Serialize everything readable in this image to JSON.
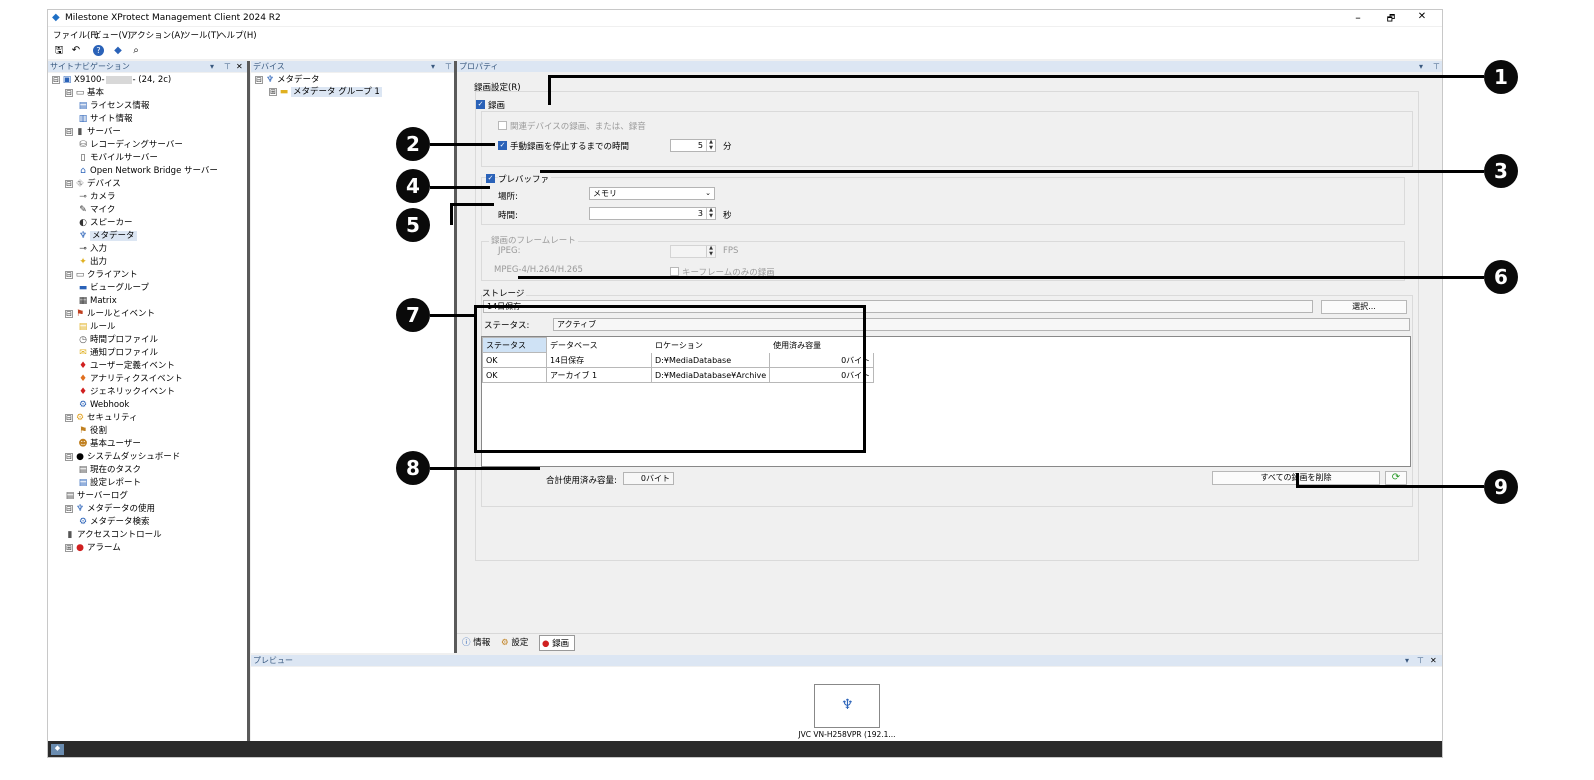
{
  "app": {
    "title": "Milestone XProtect Management Client 2024 R2",
    "minimize": "–",
    "restore": "🗗",
    "close": "✕"
  },
  "menu": [
    "ファイル(F)",
    "ビュー(V)",
    "アクション(A)",
    "ツール(T)",
    "ヘルプ(H)"
  ],
  "toolbar": {
    "save": "🖫",
    "undo": "↶",
    "help": "?",
    "connect": "◆",
    "find": "⌕"
  },
  "pane_controls": {
    "dropdown": "▾",
    "pin": "⊤",
    "close": "✕"
  },
  "site_nav": {
    "title": "サイトナビゲーション",
    "items": [
      {
        "label": "X9100-",
        "expander": "⊟"
      },
      {
        "label": "基本",
        "expander": "⊟"
      },
      {
        "label": "ライセンス情報"
      },
      {
        "label": "サイト情報"
      },
      {
        "label": "サーバー",
        "expander": "⊟"
      },
      {
        "label": "レコーディングサーバー"
      },
      {
        "label": "モバイルサーバー"
      },
      {
        "label": "Open Network Bridge サーバー"
      },
      {
        "label": "デバイス",
        "expander": "⊟"
      },
      {
        "label": "カメラ"
      },
      {
        "label": "マイク"
      },
      {
        "label": "スピーカー"
      },
      {
        "label": "メタデータ"
      },
      {
        "label": "入力"
      },
      {
        "label": "出力"
      },
      {
        "label": "クライアント",
        "expander": "⊟"
      },
      {
        "label": "ビューグループ"
      },
      {
        "label": "Matrix"
      },
      {
        "label": "ルールとイベント",
        "expander": "⊟"
      },
      {
        "label": "ルール"
      },
      {
        "label": "時間プロファイル"
      },
      {
        "label": "通知プロファイル"
      },
      {
        "label": "ユーザー定義イベント"
      },
      {
        "label": "アナリティクスイベント"
      },
      {
        "label": "ジェネリックイベント"
      },
      {
        "label": "Webhook"
      },
      {
        "label": "セキュリティ",
        "expander": "⊟"
      },
      {
        "label": "役割"
      },
      {
        "label": "基本ユーザー"
      },
      {
        "label": "システムダッシュボード",
        "expander": "⊟"
      },
      {
        "label": "現在のタスク"
      },
      {
        "label": "設定レポート"
      },
      {
        "label": "サーバーログ"
      },
      {
        "label": "メタデータの使用",
        "expander": "⊟"
      },
      {
        "label": "メタデータ検索"
      },
      {
        "label": "アクセスコントロール"
      },
      {
        "label": "アラーム",
        "expander": "⊞"
      }
    ],
    "server_suffix": "- (24, 2c)"
  },
  "devices": {
    "title": "デバイス",
    "root": "メタデータ",
    "group": "メタデータ グループ 1",
    "root_expander": "⊟",
    "group_expander": "⊞"
  },
  "properties": {
    "title": "プロパティ",
    "recording_settings": "録画設定(R)",
    "record": "録画",
    "related_devices": "関連デバイスの録画、または、録音",
    "manual_stop": "手動録画を停止するまでの時間",
    "manual_value": "5",
    "manual_unit": "分",
    "prebuffer": "プレバッファ",
    "location_label": "場所:",
    "location_value": "メモリ",
    "time_label": "時間:",
    "time_value": "3",
    "time_unit": "秒",
    "framerate_group": "録画のフレームレート",
    "jpeg": "JPEG:",
    "fps": "FPS",
    "mpeg": "MPEG-4/H.264/H.265",
    "keyframe": "キーフレームのみの録画",
    "storage_group": "ストレージ",
    "storage_value": "14日保存",
    "select_button": "選択...",
    "status_label": "ステータス:",
    "status_value": "アクティブ",
    "table_headers": [
      "ステータス",
      "データベース",
      "ロケーション",
      "使用済み容量"
    ],
    "table_rows": [
      [
        "OK",
        "14日保存",
        "D:¥MediaDatabase",
        "0バイト"
      ],
      [
        "OK",
        "アーカイブ 1",
        "D:¥MediaDatabase¥Archive",
        "0バイト"
      ]
    ],
    "total_label": "合計使用済み容量:",
    "total_value": "0バイト",
    "delete_all": "すべての録画を削除",
    "refresh": "⟳",
    "tabs": [
      "情報",
      "設定",
      "録画"
    ]
  },
  "preview": {
    "title": "プレビュー",
    "camera_label": "JVC VN-H258VPR (192.1..."
  },
  "callouts": [
    "1",
    "2",
    "3",
    "4",
    "5",
    "6",
    "7",
    "8",
    "9"
  ],
  "colors": {
    "accent": "#2a62b8",
    "header": "#dce6f3",
    "callout": "#0a0a0a"
  }
}
